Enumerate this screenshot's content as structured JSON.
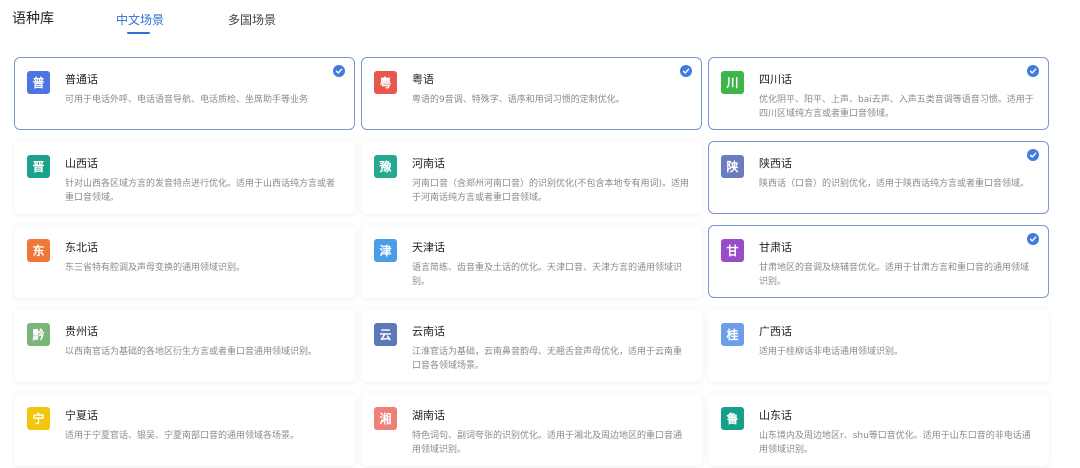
{
  "header": {
    "title": "语种库",
    "tabs": [
      {
        "label": "中文场景",
        "active": true
      },
      {
        "label": "多国场景",
        "active": false
      }
    ]
  },
  "colors": {
    "accent": "#2f6fd6",
    "selected_border": "#7b95d6",
    "check": "#3f7cdd"
  },
  "cards": [
    {
      "badge": "普",
      "badge_color": "#4c74e3",
      "name": "普通话",
      "desc": "可用于电话外呼、电话语音导航、电话质检、坐席助手等业务",
      "selected": true
    },
    {
      "badge": "粤",
      "badge_color": "#e8574b",
      "name": "粤语",
      "desc": "粤语的9音调、特殊字、语序和用词习惯的定制优化。",
      "selected": true
    },
    {
      "badge": "川",
      "badge_color": "#3fb54a",
      "name": "四川话",
      "desc": "优化阴平、阳平、上声、bai去声、入声五类音调等语音习惯。适用于四川区域纯方言或者重口音领域。",
      "selected": true
    },
    {
      "badge": "晋",
      "badge_color": "#1aa38b",
      "name": "山西话",
      "desc": "针对山西各区域方言的发音特点进行优化。适用于山西话纯方言或者重口音领域。",
      "selected": false
    },
    {
      "badge": "豫",
      "badge_color": "#26a892",
      "name": "河南话",
      "desc": "河南口音（含郑州河南口音）的识别优化(不包含本地专有用词)。适用于河南话纯方言或者重口音领域。",
      "selected": false
    },
    {
      "badge": "陕",
      "badge_color": "#6a7cbf",
      "name": "陕西话",
      "desc": "陕西话（口音）的识别优化，适用于陕西话纯方言或者重口音领域。",
      "selected": true
    },
    {
      "badge": "东",
      "badge_color": "#f0773a",
      "name": "东北话",
      "desc": "东三省特有腔调及声母变换的通用领域识别。",
      "selected": false
    },
    {
      "badge": "津",
      "badge_color": "#4a9ee6",
      "name": "天津话",
      "desc": "语言简练、齿音重及土话的优化。天津口音、天津方言的通用领域识别。",
      "selected": false
    },
    {
      "badge": "甘",
      "badge_color": "#9a4cc8",
      "name": "甘肃话",
      "desc": "甘肃地区的音调及绕辅音优化。适用于甘肃方言和重口音的通用领域识别。",
      "selected": true
    },
    {
      "badge": "黔",
      "badge_color": "#7cb57a",
      "name": "贵州话",
      "desc": "以西南官话为基础的各地区衍生方言或者重口音通用领域识别。",
      "selected": false
    },
    {
      "badge": "云",
      "badge_color": "#5d78b8",
      "name": "云南话",
      "desc": "江淮官话为基础，云南鼻音韵母、无翘舌音声母优化，适用于云南重口音各领域场景。",
      "selected": false
    },
    {
      "badge": "桂",
      "badge_color": "#6d9ee9",
      "name": "广西话",
      "desc": "适用于桂柳话非电话通用领域识别。",
      "selected": false
    },
    {
      "badge": "宁",
      "badge_color": "#f3c50c",
      "name": "宁夏话",
      "desc": "适用于宁夏官话、银吴、宁夏南部口音的通用领域各场景。",
      "selected": false
    },
    {
      "badge": "湘",
      "badge_color": "#ef7f79",
      "name": "湖南话",
      "desc": "特色词句、副词夸张的识别优化。适用于湘北及周边地区的重口音通用领域识别。",
      "selected": false
    },
    {
      "badge": "鲁",
      "badge_color": "#16a08c",
      "name": "山东话",
      "desc": "山东境内及周边地区r、shu等口音优化。适用于山东口音的非电话通用领域识别。",
      "selected": false
    }
  ]
}
